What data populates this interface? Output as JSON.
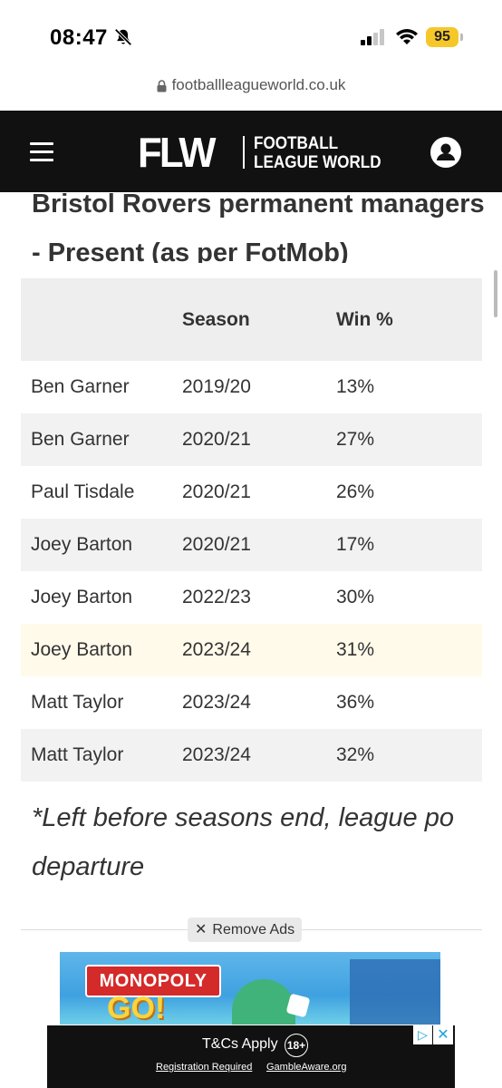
{
  "status_bar": {
    "time": "08:47",
    "battery": "95",
    "battery_color": "#f6c729"
  },
  "browser": {
    "url": "footballleagueworld.co.uk"
  },
  "header": {
    "logo_mark": "FLW",
    "logo_line1": "FOOTBALL",
    "logo_line2": "LEAGUE WORLD",
    "background": "#111111"
  },
  "article": {
    "heading_line1": "Bristol Rovers permanent managers",
    "heading_line2_prefix": "- Present (as per ",
    "heading_link": "FotMob",
    "heading_line2_suffix": ")",
    "note_line1": "*Left before seasons end, league po",
    "note_line2": "departure"
  },
  "table": {
    "headers": [
      "",
      "Season",
      "Win %"
    ],
    "rows": [
      {
        "manager": "Ben Garner",
        "season": "2019/20",
        "win": "13%"
      },
      {
        "manager": "Ben Garner",
        "season": "2020/21",
        "win": "27%"
      },
      {
        "manager": "Paul Tisdale",
        "season": "2020/21",
        "win": "26%"
      },
      {
        "manager": "Joey Barton",
        "season": "2020/21",
        "win": "17%"
      },
      {
        "manager": "Joey Barton",
        "season": "2022/23",
        "win": "30%"
      },
      {
        "manager": "Joey Barton",
        "season": "2023/24",
        "win": "31%"
      },
      {
        "manager": "Matt Taylor",
        "season": "2023/24",
        "win": "36%"
      },
      {
        "manager": "Matt Taylor",
        "season": "2023/24",
        "win": "32%"
      }
    ]
  },
  "ads": {
    "remove_ads_label": "Remove Ads",
    "ad_title_top": "MONOPOLY",
    "ad_title_bottom": "GO!",
    "tc_label": "T&Cs Apply",
    "age_label": "18+",
    "registration_label": "Registration Required",
    "gambleaware_label": "GambleAware.org"
  }
}
